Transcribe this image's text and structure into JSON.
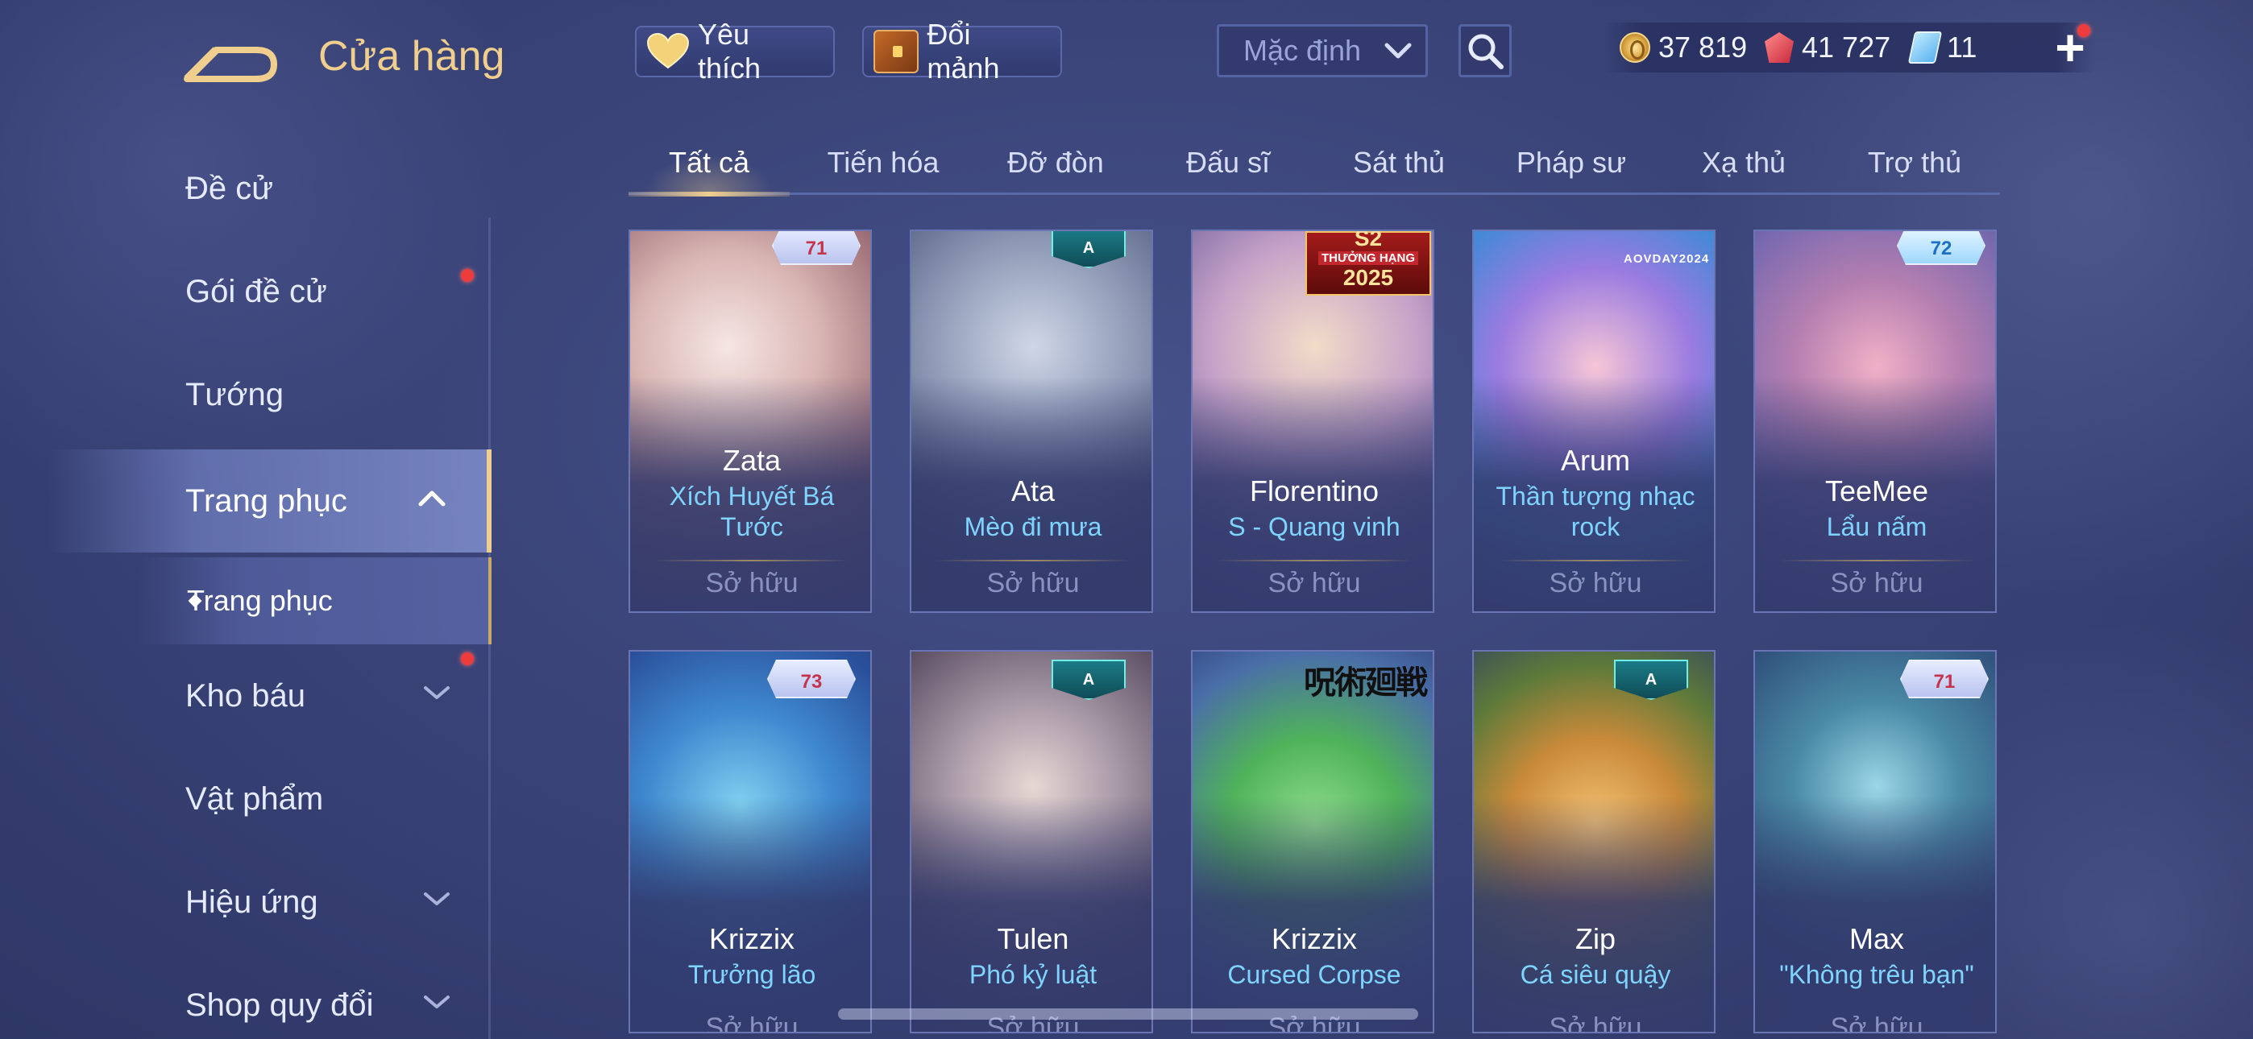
{
  "header": {
    "title": "Cửa hàng",
    "favorites_label": "Yêu thích",
    "exchange_label": "Đổi mảnh",
    "sort_value": "Mặc định"
  },
  "currencies": {
    "gold": "37 819",
    "ruby": "41 727",
    "voucher": "11"
  },
  "sidebar": {
    "items": [
      {
        "label": "Đề cử"
      },
      {
        "label": "Gói đề cử"
      },
      {
        "label": "Tướng"
      },
      {
        "label": "Trang phục"
      },
      {
        "label": "Kho báu"
      },
      {
        "label": "Vật phẩm"
      },
      {
        "label": "Hiệu ứng"
      },
      {
        "label": "Shop quy đổi"
      }
    ],
    "sub_item": "Trang phục"
  },
  "tabs": [
    "Tất cả",
    "Tiến hóa",
    "Đỡ đòn",
    "Đấu sĩ",
    "Sát thủ",
    "Pháp sư",
    "Xạ thủ",
    "Trợ thủ"
  ],
  "cards": [
    {
      "hero": "Zata",
      "skin": "Xích Huyết Bá Tước",
      "status": "Sở hữu",
      "badge_text": "71"
    },
    {
      "hero": "Ata",
      "skin": "Mèo đi mưa",
      "status": "Sở hữu",
      "badge_text": "A"
    },
    {
      "hero": "Florentino",
      "skin": "S - Quang vinh",
      "status": "Sở hữu",
      "badge_text": "S2",
      "badge_sub": "THƯỞNG HẠNG",
      "badge_year": "2025"
    },
    {
      "hero": "Arum",
      "skin": "Thần tượng nhạc rock",
      "status": "Sở hữu",
      "badge_text": "AOVDAY2024"
    },
    {
      "hero": "TeeMee",
      "skin": "Lẩu nấm",
      "status": "Sở hữu",
      "badge_text": "72"
    },
    {
      "hero": "Krizzix",
      "skin": "Trưởng lão",
      "status": "Sở hữu",
      "badge_text": "73"
    },
    {
      "hero": "Tulen",
      "skin": "Phó kỷ luật",
      "status": "Sở hữu",
      "badge_text": "A"
    },
    {
      "hero": "Krizzix",
      "skin": "Cursed Corpse",
      "status": "Sở hữu",
      "badge_text": "呪術廻戦"
    },
    {
      "hero": "Zip",
      "skin": "Cá siêu quậy",
      "status": "Sở hữu",
      "badge_text": "A"
    },
    {
      "hero": "Max",
      "skin": "\"Không trêu bạn\"",
      "status": "Sở hữu",
      "badge_text": "71"
    }
  ],
  "colors": {
    "accent_gold": "#f0cf8e",
    "skin_name_blue": "#7fd4ff",
    "notification_red": "#ee3b3b"
  }
}
